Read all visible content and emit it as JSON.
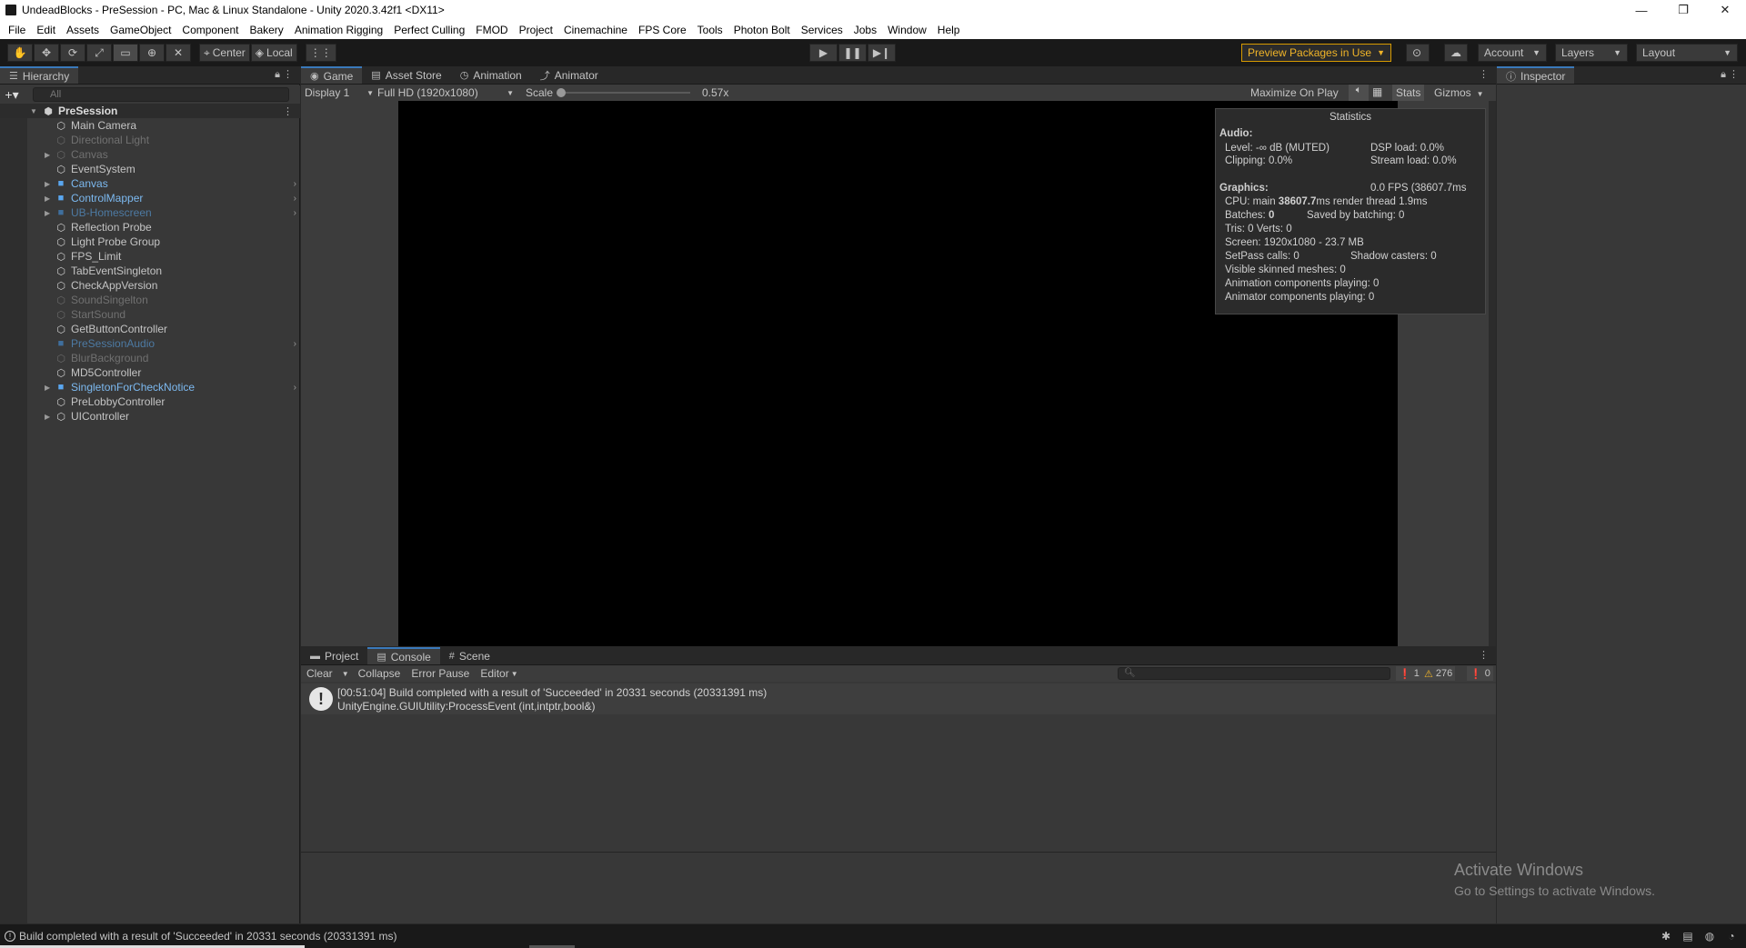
{
  "window": {
    "title": "UndeadBlocks - PreSession - PC, Mac & Linux Standalone - Unity 2020.3.42f1 <DX11>",
    "controls": {
      "minimize": "—",
      "restore": "❐",
      "close": "✕"
    }
  },
  "menu": [
    "File",
    "Edit",
    "Assets",
    "GameObject",
    "Component",
    "Bakery",
    "Animation Rigging",
    "Perfect Culling",
    "FMOD",
    "Project",
    "Cinemachine",
    "FPS Core",
    "Tools",
    "Photon Bolt",
    "Services",
    "Jobs",
    "Window",
    "Help"
  ],
  "toolbar": {
    "tools": [
      "✋",
      "✥",
      "⟳",
      "⤢",
      "▭",
      "⊕",
      "✕"
    ],
    "pivot_label": "Center",
    "space_label": "Local",
    "snap_icon": "⋮⋮",
    "play_icons": [
      "▶",
      "❚❚",
      "▶❙"
    ],
    "preview_packages": "Preview Packages in Use",
    "account": "Account",
    "layers": "Layers",
    "layout": "Layout"
  },
  "hierarchy": {
    "tab_label": "Hierarchy",
    "search_placeholder": "All",
    "root": "PreSession",
    "items": [
      {
        "label": "Main Camera",
        "state": "normal",
        "expand": false,
        "chevron": false
      },
      {
        "label": "Directional Light",
        "state": "disabled",
        "expand": false,
        "chevron": false
      },
      {
        "label": "Canvas",
        "state": "disabled",
        "expand": true,
        "chevron": false
      },
      {
        "label": "EventSystem",
        "state": "normal",
        "expand": false,
        "chevron": false
      },
      {
        "label": "Canvas",
        "state": "prefab",
        "expand": true,
        "chevron": true
      },
      {
        "label": "ControlMapper",
        "state": "prefab",
        "expand": true,
        "chevron": true
      },
      {
        "label": "UB-Homescreen",
        "state": "prefab-disabled",
        "expand": true,
        "chevron": true
      },
      {
        "label": "Reflection Probe",
        "state": "normal",
        "expand": false,
        "chevron": false
      },
      {
        "label": "Light Probe Group",
        "state": "normal",
        "expand": false,
        "chevron": false
      },
      {
        "label": "FPS_Limit",
        "state": "normal",
        "expand": false,
        "chevron": false
      },
      {
        "label": "TabEventSingleton",
        "state": "normal",
        "expand": false,
        "chevron": false
      },
      {
        "label": "CheckAppVersion",
        "state": "normal",
        "expand": false,
        "chevron": false
      },
      {
        "label": "SoundSingelton",
        "state": "disabled",
        "expand": false,
        "chevron": false
      },
      {
        "label": "StartSound",
        "state": "disabled",
        "expand": false,
        "chevron": false
      },
      {
        "label": "GetButtonController",
        "state": "normal",
        "expand": false,
        "chevron": false
      },
      {
        "label": "PreSessionAudio",
        "state": "prefab-disabled",
        "expand": false,
        "chevron": true
      },
      {
        "label": "BlurBackground",
        "state": "disabled",
        "expand": false,
        "chevron": false
      },
      {
        "label": "MD5Controller",
        "state": "normal",
        "expand": false,
        "chevron": false
      },
      {
        "label": "SingletonForCheckNotice",
        "state": "prefab",
        "expand": true,
        "chevron": true
      },
      {
        "label": "PreLobbyController",
        "state": "normal",
        "expand": false,
        "chevron": false
      },
      {
        "label": "UIController",
        "state": "normal",
        "expand": true,
        "chevron": false
      }
    ]
  },
  "game": {
    "tabs": [
      {
        "label": "Game",
        "icon": "◉",
        "active": true
      },
      {
        "label": "Asset Store",
        "icon": "🛍",
        "active": false
      },
      {
        "label": "Animation",
        "icon": "◷",
        "active": false
      },
      {
        "label": "Animator",
        "icon": "⤴",
        "active": false
      }
    ],
    "display": "Display 1",
    "resolution": "Full HD (1920x1080)",
    "scale_label": "Scale",
    "scale_value": "0.57x",
    "scale_fraction": 0.0,
    "maximize": "Maximize On Play",
    "stats": "Stats",
    "gizmos": "Gizmos"
  },
  "statistics": {
    "title": "Statistics",
    "audio_header": "Audio:",
    "level": "Level: -∞ dB (MUTED)",
    "dsp": "DSP load: 0.0%",
    "clipping": "Clipping: 0.0%",
    "stream": "Stream load: 0.0%",
    "graphics_header": "Graphics:",
    "fps": "0.0 FPS (38607.7ms",
    "cpu_prefix": "CPU: main ",
    "cpu_main": "38607.7",
    "cpu_suffix": "ms  render thread 1.9ms",
    "batches_prefix": "Batches: ",
    "batches": "0",
    "saved": "Saved by batching: 0",
    "tris": "Tris: 0   Verts: 0",
    "screen": "Screen: 1920x1080 - 23.7 MB",
    "setpass": "SetPass calls: 0",
    "shadow": "Shadow casters: 0",
    "skinned": "Visible skinned meshes: 0",
    "anim_comp": "Animation components playing: 0",
    "animator_comp": "Animator components playing: 0"
  },
  "console": {
    "tabs": [
      {
        "label": "Project",
        "icon": "▬",
        "active": false
      },
      {
        "label": "Console",
        "icon": "▤",
        "active": true
      },
      {
        "label": "Scene",
        "icon": "#",
        "active": false
      }
    ],
    "clear": "Clear",
    "collapse": "Collapse",
    "error_pause": "Error Pause",
    "editor": "Editor",
    "count_info": "1",
    "count_warn": "276",
    "count_error": "0",
    "entry_line1": "[00:51:04] Build completed with a result of 'Succeeded' in 20331 seconds (20331391 ms)",
    "entry_line2": "UnityEngine.GUIUtility:ProcessEvent (int,intptr,bool&)"
  },
  "inspector": {
    "tab_label": "Inspector"
  },
  "watermark": {
    "line1": "Activate Windows",
    "line2": "Go to Settings to activate Windows."
  },
  "status": {
    "message": "Build completed with a result of 'Succeeded' in 20331 seconds (20331391 ms)"
  }
}
